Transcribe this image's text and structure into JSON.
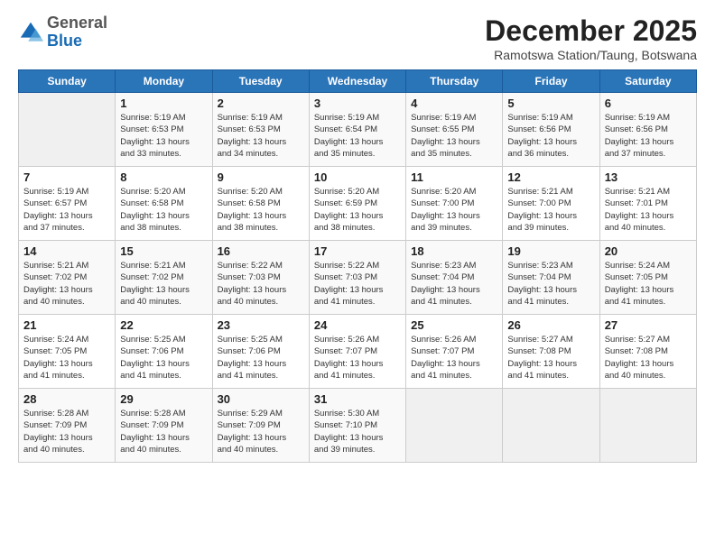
{
  "logo": {
    "general": "General",
    "blue": "Blue"
  },
  "header": {
    "month": "December 2025",
    "location": "Ramotswa Station/Taung, Botswana"
  },
  "days_of_week": [
    "Sunday",
    "Monday",
    "Tuesday",
    "Wednesday",
    "Thursday",
    "Friday",
    "Saturday"
  ],
  "weeks": [
    [
      {
        "day": "",
        "info": ""
      },
      {
        "day": "1",
        "info": "Sunrise: 5:19 AM\nSunset: 6:53 PM\nDaylight: 13 hours\nand 33 minutes."
      },
      {
        "day": "2",
        "info": "Sunrise: 5:19 AM\nSunset: 6:53 PM\nDaylight: 13 hours\nand 34 minutes."
      },
      {
        "day": "3",
        "info": "Sunrise: 5:19 AM\nSunset: 6:54 PM\nDaylight: 13 hours\nand 35 minutes."
      },
      {
        "day": "4",
        "info": "Sunrise: 5:19 AM\nSunset: 6:55 PM\nDaylight: 13 hours\nand 35 minutes."
      },
      {
        "day": "5",
        "info": "Sunrise: 5:19 AM\nSunset: 6:56 PM\nDaylight: 13 hours\nand 36 minutes."
      },
      {
        "day": "6",
        "info": "Sunrise: 5:19 AM\nSunset: 6:56 PM\nDaylight: 13 hours\nand 37 minutes."
      }
    ],
    [
      {
        "day": "7",
        "info": "Sunrise: 5:19 AM\nSunset: 6:57 PM\nDaylight: 13 hours\nand 37 minutes."
      },
      {
        "day": "8",
        "info": "Sunrise: 5:20 AM\nSunset: 6:58 PM\nDaylight: 13 hours\nand 38 minutes."
      },
      {
        "day": "9",
        "info": "Sunrise: 5:20 AM\nSunset: 6:58 PM\nDaylight: 13 hours\nand 38 minutes."
      },
      {
        "day": "10",
        "info": "Sunrise: 5:20 AM\nSunset: 6:59 PM\nDaylight: 13 hours\nand 38 minutes."
      },
      {
        "day": "11",
        "info": "Sunrise: 5:20 AM\nSunset: 7:00 PM\nDaylight: 13 hours\nand 39 minutes."
      },
      {
        "day": "12",
        "info": "Sunrise: 5:21 AM\nSunset: 7:00 PM\nDaylight: 13 hours\nand 39 minutes."
      },
      {
        "day": "13",
        "info": "Sunrise: 5:21 AM\nSunset: 7:01 PM\nDaylight: 13 hours\nand 40 minutes."
      }
    ],
    [
      {
        "day": "14",
        "info": "Sunrise: 5:21 AM\nSunset: 7:02 PM\nDaylight: 13 hours\nand 40 minutes."
      },
      {
        "day": "15",
        "info": "Sunrise: 5:21 AM\nSunset: 7:02 PM\nDaylight: 13 hours\nand 40 minutes."
      },
      {
        "day": "16",
        "info": "Sunrise: 5:22 AM\nSunset: 7:03 PM\nDaylight: 13 hours\nand 40 minutes."
      },
      {
        "day": "17",
        "info": "Sunrise: 5:22 AM\nSunset: 7:03 PM\nDaylight: 13 hours\nand 41 minutes."
      },
      {
        "day": "18",
        "info": "Sunrise: 5:23 AM\nSunset: 7:04 PM\nDaylight: 13 hours\nand 41 minutes."
      },
      {
        "day": "19",
        "info": "Sunrise: 5:23 AM\nSunset: 7:04 PM\nDaylight: 13 hours\nand 41 minutes."
      },
      {
        "day": "20",
        "info": "Sunrise: 5:24 AM\nSunset: 7:05 PM\nDaylight: 13 hours\nand 41 minutes."
      }
    ],
    [
      {
        "day": "21",
        "info": "Sunrise: 5:24 AM\nSunset: 7:05 PM\nDaylight: 13 hours\nand 41 minutes."
      },
      {
        "day": "22",
        "info": "Sunrise: 5:25 AM\nSunset: 7:06 PM\nDaylight: 13 hours\nand 41 minutes."
      },
      {
        "day": "23",
        "info": "Sunrise: 5:25 AM\nSunset: 7:06 PM\nDaylight: 13 hours\nand 41 minutes."
      },
      {
        "day": "24",
        "info": "Sunrise: 5:26 AM\nSunset: 7:07 PM\nDaylight: 13 hours\nand 41 minutes."
      },
      {
        "day": "25",
        "info": "Sunrise: 5:26 AM\nSunset: 7:07 PM\nDaylight: 13 hours\nand 41 minutes."
      },
      {
        "day": "26",
        "info": "Sunrise: 5:27 AM\nSunset: 7:08 PM\nDaylight: 13 hours\nand 41 minutes."
      },
      {
        "day": "27",
        "info": "Sunrise: 5:27 AM\nSunset: 7:08 PM\nDaylight: 13 hours\nand 40 minutes."
      }
    ],
    [
      {
        "day": "28",
        "info": "Sunrise: 5:28 AM\nSunset: 7:09 PM\nDaylight: 13 hours\nand 40 minutes."
      },
      {
        "day": "29",
        "info": "Sunrise: 5:28 AM\nSunset: 7:09 PM\nDaylight: 13 hours\nand 40 minutes."
      },
      {
        "day": "30",
        "info": "Sunrise: 5:29 AM\nSunset: 7:09 PM\nDaylight: 13 hours\nand 40 minutes."
      },
      {
        "day": "31",
        "info": "Sunrise: 5:30 AM\nSunset: 7:10 PM\nDaylight: 13 hours\nand 39 minutes."
      },
      {
        "day": "",
        "info": ""
      },
      {
        "day": "",
        "info": ""
      },
      {
        "day": "",
        "info": ""
      }
    ]
  ]
}
